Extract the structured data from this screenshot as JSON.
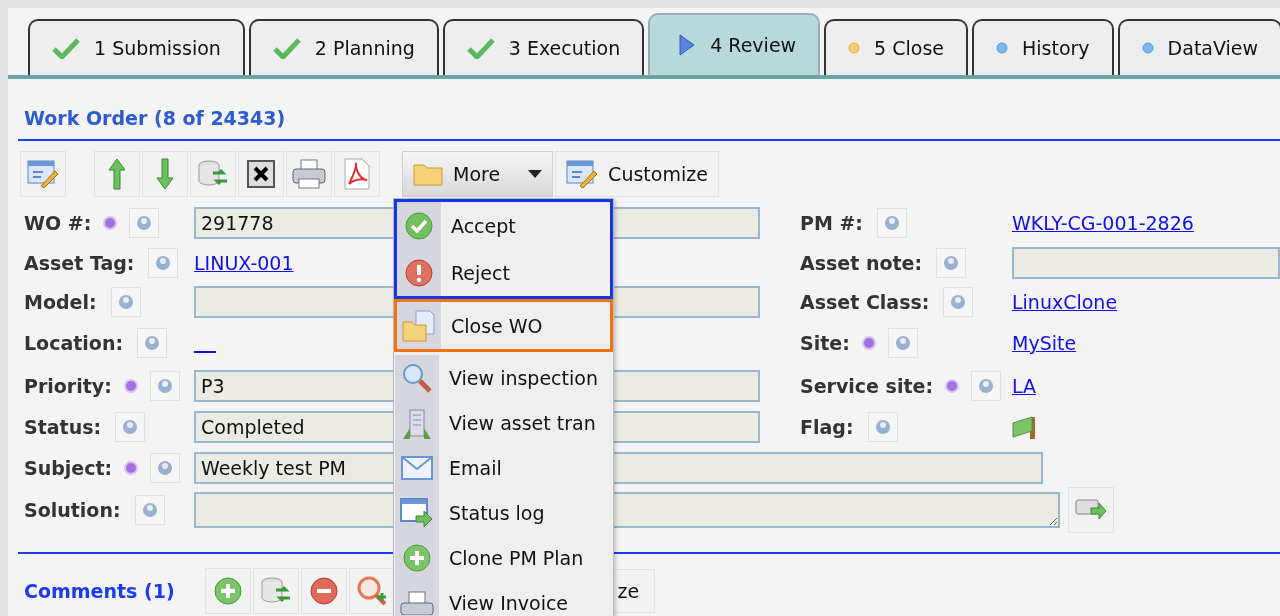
{
  "tabs": [
    {
      "label": "1 Submission",
      "kind": "done",
      "selected": false
    },
    {
      "label": "2 Planning",
      "kind": "done",
      "selected": false
    },
    {
      "label": "3 Execution",
      "kind": "done",
      "selected": false
    },
    {
      "label": "4 Review",
      "kind": "current",
      "selected": true
    },
    {
      "label": "5 Close",
      "kind": "pending",
      "selected": false
    },
    {
      "label": "History",
      "kind": "info",
      "selected": false
    },
    {
      "label": "DataView",
      "kind": "info",
      "selected": false
    }
  ],
  "form": {
    "title": "Work Order (8 of 24343)",
    "toolbar": {
      "more": "More",
      "customize": "Customize"
    },
    "rows": [
      {
        "left": {
          "label": "WO #:",
          "required": true,
          "kind": "input",
          "value": "291778"
        },
        "right": {
          "label": "PM #:",
          "required": false,
          "kind": "link",
          "value": "WKLY-CG-001-2826"
        }
      },
      {
        "left": {
          "label": "Asset Tag:",
          "required": false,
          "kind": "link",
          "value": "LINUX-001"
        },
        "right": {
          "label": "Asset note:",
          "required": false,
          "kind": "input"
        }
      },
      {
        "left": {
          "label": "Model:",
          "required": false,
          "kind": "input"
        },
        "right": {
          "label": "Asset Class:",
          "required": false,
          "kind": "link",
          "value": "LinuxClone"
        }
      },
      {
        "left": {
          "label": "Location:",
          "required": false,
          "kind": "empty-link"
        },
        "right": {
          "label": "Site:",
          "required": true,
          "kind": "link",
          "value": "MySite"
        }
      },
      {
        "left": {
          "label": "Priority:",
          "required": true,
          "kind": "input",
          "value": "P3"
        },
        "right": {
          "label": "Service site:",
          "required": true,
          "kind": "link",
          "value": "LA"
        }
      },
      {
        "left": {
          "label": "Status:",
          "required": false,
          "kind": "input",
          "value": "Completed"
        },
        "right": {
          "label": "Flag:",
          "required": false,
          "kind": "flag"
        }
      },
      {
        "left": {
          "label": "Subject:",
          "required": true,
          "kind": "wide-input",
          "value": "Weekly test PM"
        }
      },
      {
        "left": {
          "label": "Solution:",
          "required": false,
          "kind": "textarea"
        }
      }
    ]
  },
  "comments": {
    "title": "Comments (1)",
    "customize": "ze"
  },
  "more_menu": {
    "groups": [
      {
        "color": "#1436e8",
        "items": [
          {
            "label": "Accept",
            "kind": "accept"
          },
          {
            "label": "Reject",
            "kind": "reject"
          }
        ]
      },
      {
        "color": "#f2720f",
        "items": [
          {
            "label": "Close WO",
            "kind": "close"
          }
        ]
      },
      {
        "items": [
          {
            "label": "View inspection",
            "kind": "inspect"
          },
          {
            "label": "View asset tran",
            "kind": "building"
          },
          {
            "label": "Email",
            "kind": "email"
          },
          {
            "label": "Status log",
            "kind": "log"
          },
          {
            "label": "Clone PM Plan",
            "kind": "clone"
          },
          {
            "label": "View Invoice",
            "kind": "invoice"
          }
        ]
      }
    ]
  }
}
